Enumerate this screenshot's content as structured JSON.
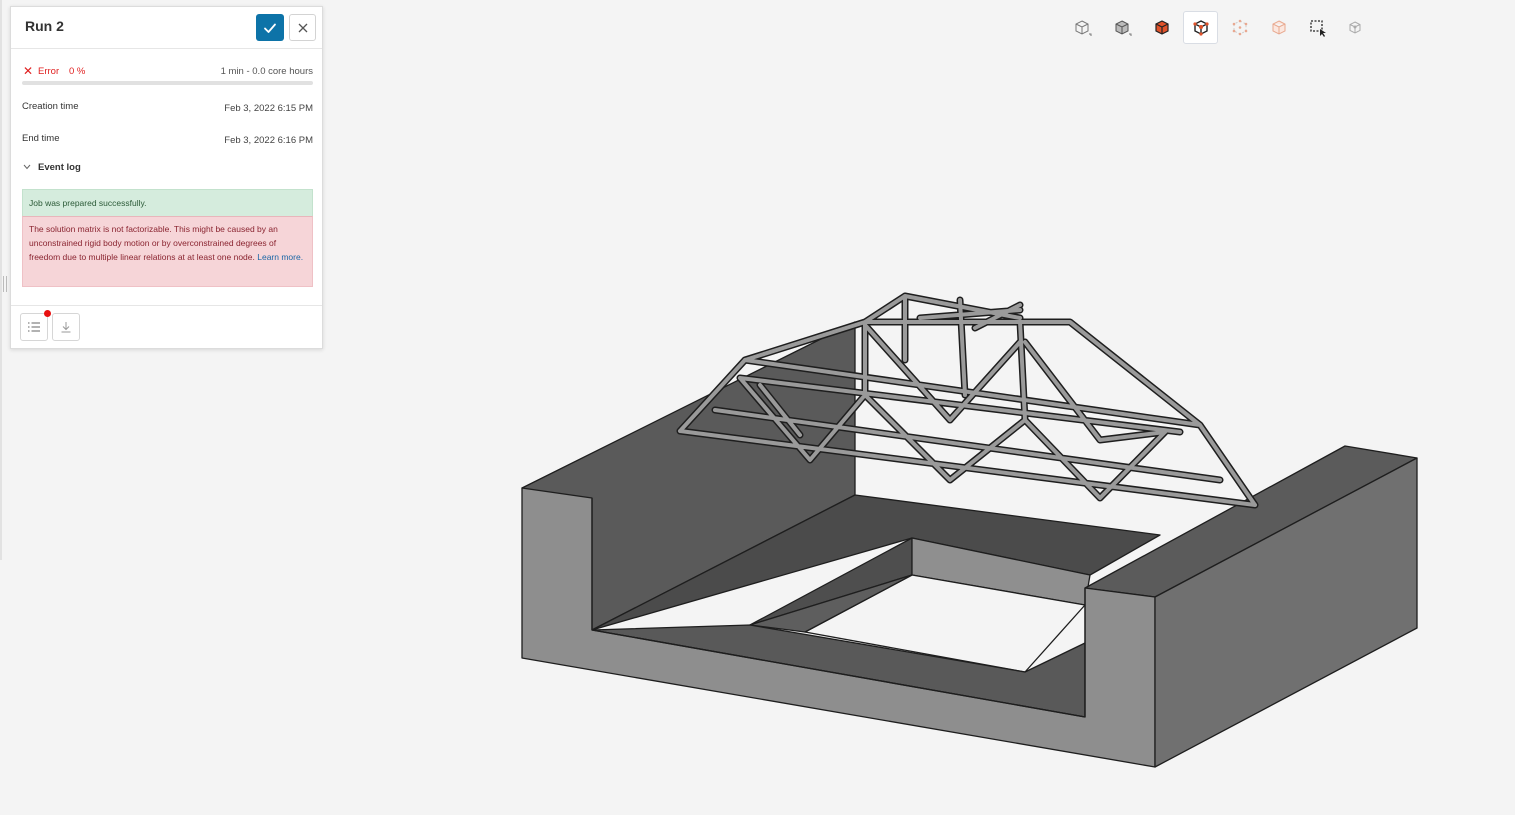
{
  "panel": {
    "title": "Run 2",
    "status": {
      "label": "Error",
      "percent": "0 %",
      "duration": "1 min - 0.0 core hours",
      "progress": 0.0,
      "color": "#e02020"
    },
    "creation_time": {
      "label": "Creation time",
      "value": "Feb 3, 2022 6:15 PM"
    },
    "end_time": {
      "label": "End time",
      "value": "Feb 3, 2022 6:16 PM"
    },
    "event_log": {
      "label": "Event log",
      "success_message": "Job was prepared successfully.",
      "error_message": "The solution matrix is not factorizable. This might be caused by an unconstrained rigid body motion or by overconstrained degrees of freedom due to multiple linear relations at at least one node.",
      "learn_more": "Learn more."
    },
    "footer": {
      "log_icon": "list-icon",
      "download_icon": "download-icon"
    }
  },
  "toolbar": {
    "icons": [
      "view-cube-wireframe-icon",
      "view-cube-solid-icon",
      "view-cube-faces-icon",
      "view-cube-vertex-icon",
      "view-cube-points-icon",
      "view-cube-ghost-icon",
      "box-select-icon",
      "hidden-select-icon"
    ],
    "active_index": 3
  },
  "colors": {
    "accent": "#0d73a8",
    "error": "#e02020",
    "success_bg": "#d5ecdd",
    "error_bg": "#f6d5d8",
    "model_orange": "#e0522a"
  }
}
